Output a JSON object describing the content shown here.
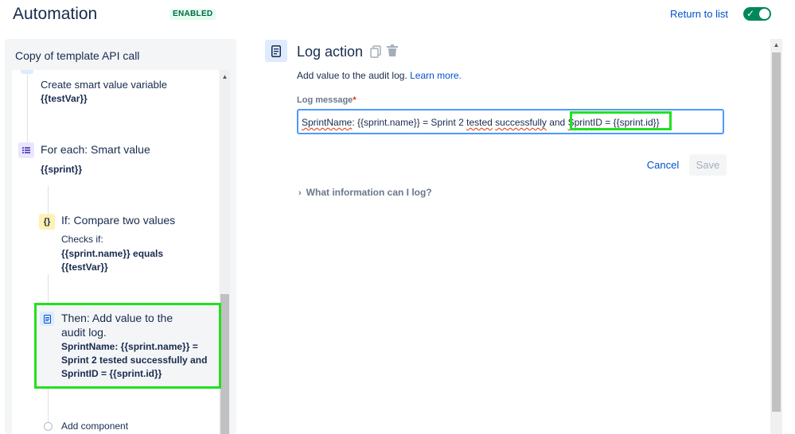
{
  "header": {
    "title": "Automation",
    "status_badge": "ENABLED",
    "return_link": "Return to list",
    "toggle_check": "✓"
  },
  "rule_panel": {
    "title": "Copy of template API call",
    "steps": [
      {
        "label": "Create smart value variable",
        "bold": "{{testVar}}"
      },
      {
        "label": "For each: Smart value",
        "bold": "{{sprint}}"
      },
      {
        "label": "If: Compare two values",
        "sub": "Checks if:",
        "bold_lines": [
          "{{sprint.name}} equals",
          "{{testVar}}"
        ],
        "icon_text": "{}"
      },
      {
        "label_lines": [
          "Then: Add value to the",
          "audit log."
        ],
        "bold_lines": [
          "SprintName: {{sprint.name}} =",
          "Sprint 2 tested successfully and",
          "SprintID = {{sprint.id}}"
        ]
      }
    ],
    "add_component": "Add component"
  },
  "action": {
    "title": "Log action",
    "description": "Add value to the audit log.",
    "learn_more": "Learn more.",
    "field_label": "Log message",
    "required_mark": "*",
    "log_message": {
      "part1": "SprintName",
      "part2": ": {{sprint.name}} = Sprint 2 ",
      "part3": "tested",
      "part4": " ",
      "part5": "successfully",
      "part6": " and ",
      "part7": "SprintID",
      "part8": " = {{sprint.id}}"
    },
    "cancel_label": "Cancel",
    "save_label": "Save",
    "info_toggle": "What information can I log?"
  },
  "colors": {
    "accent": "#0052cc",
    "toggle_on": "#00875a",
    "highlight": "#21e021"
  },
  "icons": [
    "check-icon",
    "list-icon",
    "braces-icon",
    "document-icon",
    "copy-icon",
    "trash-icon",
    "chevron-right-icon"
  ]
}
